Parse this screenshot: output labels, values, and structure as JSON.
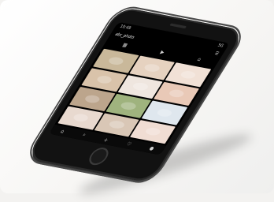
{
  "scene": {
    "background": "#f3f2f0",
    "phone_color": "#121212"
  },
  "screen": {
    "status_left": "10:49",
    "status_right": "5G",
    "profile_name": "abc_photo",
    "top_icons": [
      "grid-icon",
      "video-icon",
      "tag-icon"
    ],
    "bottom_icons": [
      "home-icon",
      "search-icon",
      "add-icon",
      "heart-icon",
      "profile-icon"
    ]
  },
  "tiles": [
    {
      "color": "#c9b89a"
    },
    {
      "color": "#e6d2c0"
    },
    {
      "color": "#f1e1d6"
    },
    {
      "color": "#d9c3aa"
    },
    {
      "color": "#efe6df"
    },
    {
      "color": "#e9c9b7"
    },
    {
      "color": "#bca58c"
    },
    {
      "color": "#9fb37e"
    },
    {
      "color": "#dfe7ee"
    },
    {
      "color": "#e8d9cf"
    },
    {
      "color": "#d9c7b6"
    },
    {
      "color": "#f0ddd3"
    }
  ]
}
